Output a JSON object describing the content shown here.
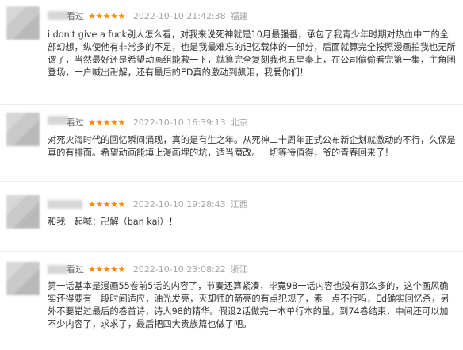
{
  "colors": {
    "star": "#ff8a00",
    "text": "#333333",
    "meta": "#a5a5a5"
  },
  "reviews": [
    {
      "status": "看过",
      "stars": "★★★★★",
      "time": "2022-10-10 21:42:38",
      "location": "福建",
      "text": "i don't give a fuck别人怎么看，对我来说死神就是10月最强番，承包了我青少年时期对热血中二的全部幻想，纵使他有非常多的不足，也是我最难忘的记忆载体的一部分，后面就算完全按照漫画拍我也无所谓了，当然最好还是希望动画组能救一下，就算完全复刻我也五星奉上，在公司偷偷看完第一集，主角团登场，一户喊出卍解，还有最后的ED真的激动到飙泪，我爱你们！"
    },
    {
      "status": "看过",
      "stars": "★★★★★",
      "time": "2022-10-10 16:39:13",
      "location": "北京",
      "text": "对死火海时代的回忆瞬间涌现，真的是有生之年。从死神二十周年正式公布新企划就激动的不行，久保是真的有排面。希望动画能填上漫画埋的坑，适当魔改。一切等待值得，爷的青春回来了！"
    },
    {
      "status": "",
      "stars": "★★★★★",
      "time": "2022-10-10 19:28:43",
      "location": "江西",
      "text": "和我一起喊：卍解（ban kai）！"
    },
    {
      "status": "看过",
      "stars": "★★★★★",
      "time": "2022-10-10 23:08:22",
      "location": "浙江",
      "text": "第一话基本是漫画55卷前5话的内容了，节奏还算紧凑，毕竟98一话内容也没有那么多的，这个画风确实还得要有一段时间适应，油光发亮，灭却师的箭亮的有点犯规了，素一点不行吗，Ed确实回忆杀，另外不要错过最后的卷首诗，诗人98的精华。假设2话做完一本单行本的量，到74卷结束，中间还可以加不少内容了，求求了，最后把四大贵族篇也做了吧。"
    }
  ]
}
